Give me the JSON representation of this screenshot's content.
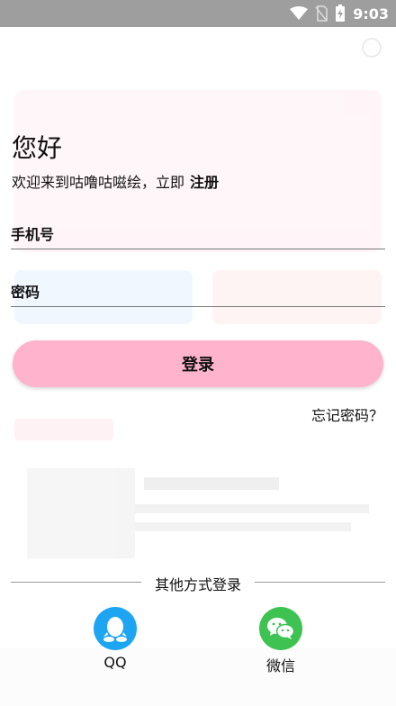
{
  "status_bar": {
    "time": "9:03"
  },
  "login": {
    "title": "您好",
    "welcome_text": "欢迎来到咕噜咕嗞绘，立即",
    "register_label": "注册",
    "phone_placeholder": "手机号",
    "password_placeholder": "密码",
    "login_button_label": "登录",
    "forgot_password_label": "忘记密码？"
  },
  "other_login": {
    "divider_text": "其他方式登录",
    "options": [
      {
        "label": "QQ",
        "icon": "qq-penguin-icon",
        "color": "#1ea5f2"
      },
      {
        "label": "微信",
        "icon": "wechat-icon",
        "color": "#3ec352"
      }
    ]
  },
  "colors": {
    "login_button": "#ffb3cc",
    "status_bar": "#9e9e9e"
  }
}
